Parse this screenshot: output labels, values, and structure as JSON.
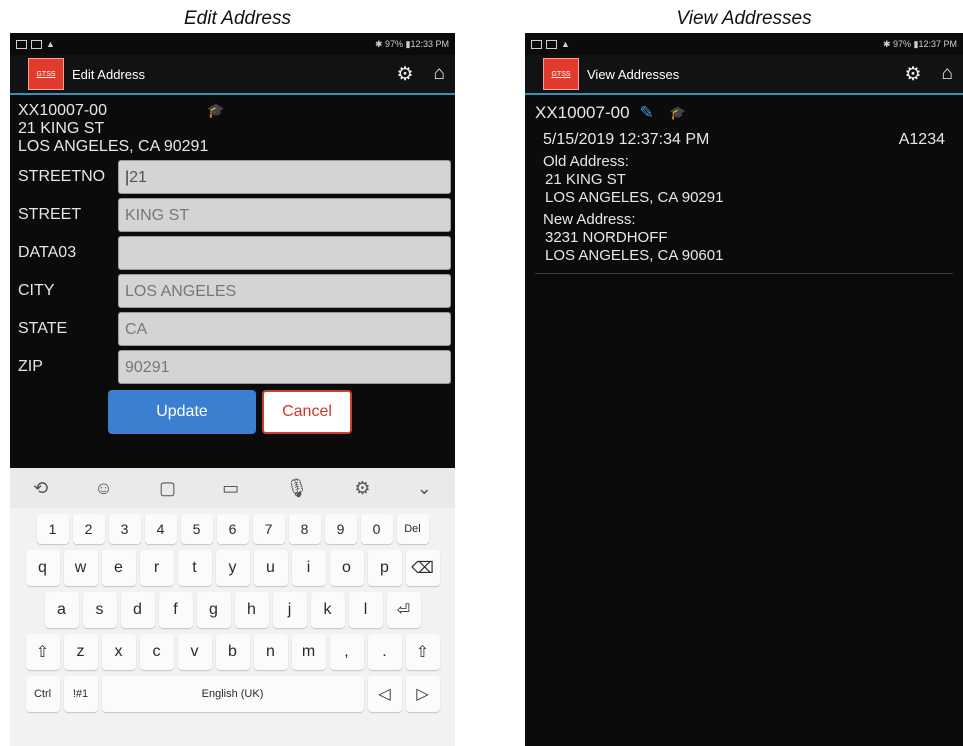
{
  "captions": {
    "left": "Edit Address",
    "right": "View Addresses"
  },
  "status_left": {
    "battery": "97%",
    "time": "12:33 PM"
  },
  "status_right": {
    "battery": "97%",
    "time": "12:37 PM"
  },
  "logo_text": "GTSS",
  "edit": {
    "title": "Edit Address",
    "account": "XX10007-00",
    "address_line1": "21 KING ST",
    "address_line2": "LOS ANGELES, CA 90291",
    "fields": [
      {
        "label": "STREETNO",
        "value": "21"
      },
      {
        "label": "STREET",
        "value": "KING ST"
      },
      {
        "label": "DATA03",
        "value": ""
      },
      {
        "label": "CITY",
        "value": "LOS ANGELES"
      },
      {
        "label": "STATE",
        "value": "CA"
      },
      {
        "label": "ZIP",
        "value": "90291"
      }
    ],
    "update_label": "Update",
    "cancel_label": "Cancel"
  },
  "keyboard": {
    "numbers": [
      "1",
      "2",
      "3",
      "4",
      "5",
      "6",
      "7",
      "8",
      "9",
      "0",
      "Del"
    ],
    "row1": [
      "q",
      "w",
      "e",
      "r",
      "t",
      "y",
      "u",
      "i",
      "o",
      "p"
    ],
    "row2": [
      "a",
      "s",
      "d",
      "f",
      "g",
      "h",
      "j",
      "k",
      "l"
    ],
    "row3": [
      "z",
      "x",
      "c",
      "v",
      "b",
      "n",
      "m",
      ",",
      "."
    ],
    "ctrl": "Ctrl",
    "sym": "!#1",
    "space": "English (UK)"
  },
  "view": {
    "title": "View Addresses",
    "account": "XX10007-00",
    "entry": {
      "timestamp": "5/15/2019 12:37:34 PM",
      "code": "A1234",
      "old_label": "Old Address:",
      "old_line1": "21 KING ST",
      "old_line2": "LOS ANGELES, CA 90291",
      "new_label": "New Address:",
      "new_line1": "3231 NORDHOFF",
      "new_line2": "LOS ANGELES, CA 90601"
    }
  },
  "colors": {
    "accent": "#3a8fb5",
    "update": "#3a7fd0",
    "cancel": "#c84030",
    "logo": "#e23b2e"
  }
}
